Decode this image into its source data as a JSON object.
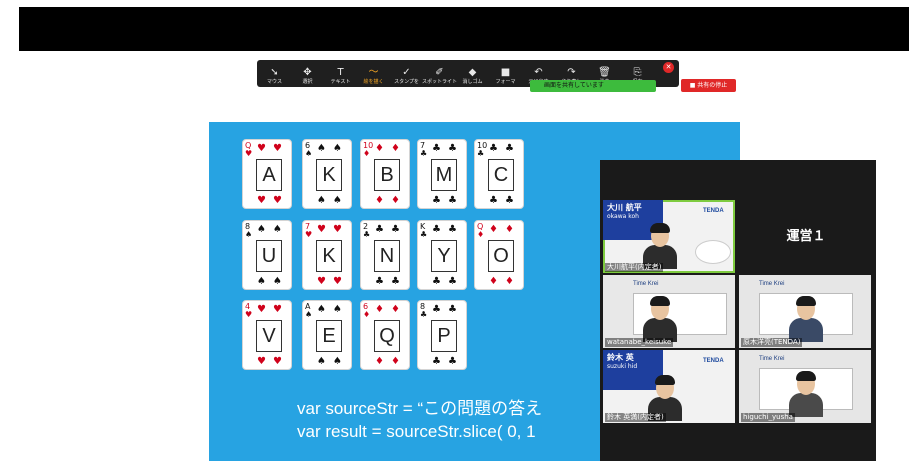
{
  "toolbar": {
    "items": [
      {
        "icon": "cursor-icon",
        "glyph": "➘",
        "label": "マウス"
      },
      {
        "icon": "move-icon",
        "glyph": "✥",
        "label": "選択"
      },
      {
        "icon": "text-icon",
        "glyph": "T",
        "label": "テキスト"
      },
      {
        "icon": "draw-icon",
        "glyph": "〜",
        "label": "絵を描く"
      },
      {
        "icon": "stamp-icon",
        "glyph": "✓",
        "label": "スタンプを"
      },
      {
        "icon": "spotlight-icon",
        "glyph": "✐",
        "label": "スポットライト"
      },
      {
        "icon": "eraser-icon",
        "glyph": "◆",
        "label": "消しゴム"
      },
      {
        "icon": "format-icon",
        "glyph": "■",
        "label": "フォーマ"
      },
      {
        "icon": "undo-icon",
        "glyph": "↶",
        "label": "元に戻す"
      },
      {
        "icon": "redo-icon",
        "glyph": "↷",
        "label": "やり直し"
      },
      {
        "icon": "trash-icon",
        "glyph": "🗑",
        "label": "消去"
      },
      {
        "icon": "save-icon",
        "glyph": "⎘",
        "label": "保存"
      }
    ],
    "active_index": 3,
    "active_color": "#f5a623"
  },
  "share": {
    "status_text": "画面を共有しています",
    "stop_label": "■ 共有の停止"
  },
  "cards": [
    {
      "rank": "Q",
      "suit": "♥",
      "color": "red",
      "letter": "A"
    },
    {
      "rank": "6",
      "suit": "♠",
      "color": "black",
      "letter": "K"
    },
    {
      "rank": "10",
      "suit": "♦",
      "color": "red",
      "letter": "B"
    },
    {
      "rank": "7",
      "suit": "♣",
      "color": "black",
      "letter": "M"
    },
    {
      "rank": "10",
      "suit": "♣",
      "color": "black",
      "letter": "C"
    },
    {
      "rank": "8",
      "suit": "♠",
      "color": "black",
      "letter": "U"
    },
    {
      "rank": "7",
      "suit": "♥",
      "color": "red",
      "letter": "K"
    },
    {
      "rank": "2",
      "suit": "♣",
      "color": "black",
      "letter": "N"
    },
    {
      "rank": "K",
      "suit": "♣",
      "color": "black",
      "letter": "Y"
    },
    {
      "rank": "Q",
      "suit": "♦",
      "color": "red",
      "letter": "O"
    },
    {
      "rank": "4",
      "suit": "♥",
      "color": "red",
      "letter": "V"
    },
    {
      "rank": "A",
      "suit": "♠",
      "color": "black",
      "letter": "E"
    },
    {
      "rank": "6",
      "suit": "♦",
      "color": "red",
      "letter": "Q"
    },
    {
      "rank": "8",
      "suit": "♣",
      "color": "black",
      "letter": "P"
    }
  ],
  "code": {
    "line1": "var sourceStr = “この問題の答え",
    "line2": "var result = sourceStr.slice( 0, 1"
  },
  "participants": {
    "p1": {
      "banner": "大川 航平",
      "sub": "okawa koh",
      "name": "大川航平(内定者)",
      "logo": "TENDA"
    },
    "unei": "運営１",
    "p2": {
      "name": "watanabe_keisuke",
      "logo": "Time Krei"
    },
    "p3": {
      "name": "原木洋亮(TENDA)",
      "logo": "Time Krei"
    },
    "p4": {
      "banner": "鈴木 英",
      "sub": "suzuki hid",
      "name": "鈴木 英満(内定者)",
      "logo": "TENDA"
    },
    "p5": {
      "name": "higuchi_yusha",
      "logo": "Time Krei"
    }
  },
  "colors": {
    "slide_bg": "#27a3e2",
    "share_green": "#3dbb3d",
    "stop_red": "#e02828",
    "active_outline": "#7ecb3f"
  }
}
